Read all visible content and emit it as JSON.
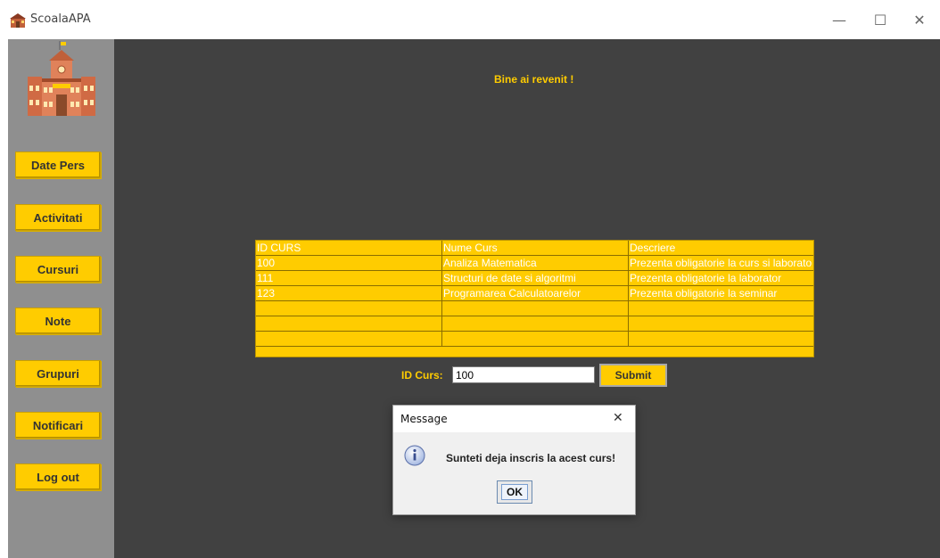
{
  "window": {
    "title": "ScoalaAPA",
    "icon": "school-icon",
    "controls": {
      "minimize": "—",
      "maximize": "☐",
      "close": "✕"
    }
  },
  "sidebar": {
    "logo": "school-building-logo",
    "items": [
      {
        "label": "Date Pers"
      },
      {
        "label": "Activitati"
      },
      {
        "label": "Cursuri"
      },
      {
        "label": "Note"
      },
      {
        "label": "Grupuri"
      },
      {
        "label": "Notificari"
      },
      {
        "label": "Log out"
      }
    ]
  },
  "main": {
    "welcome": "Bine ai revenit !",
    "table": {
      "headers": [
        "ID CURS",
        "Nume Curs",
        "Descriere"
      ],
      "rows": [
        [
          "100",
          "Analiza Matematica",
          "Prezenta obligatorie la curs si laborato"
        ],
        [
          "111",
          "Structuri de date si algoritmi",
          "Prezenta obligatorie la laborator"
        ],
        [
          "123",
          "Programarea Calculatoarelor",
          "Prezenta obligatorie la seminar"
        ],
        [
          "",
          "",
          ""
        ],
        [
          "",
          "",
          ""
        ],
        [
          "",
          "",
          ""
        ]
      ]
    },
    "id_label": "ID Curs:",
    "id_value": "100",
    "submit_label": "Submit"
  },
  "dialog": {
    "title": "Message",
    "close": "✕",
    "icon": "info-icon",
    "message": "Sunteti deja inscris la acest curs!",
    "ok_label": "OK"
  },
  "colors": {
    "accent": "#ffcc00",
    "main_bg": "#414141",
    "sidebar_bg": "#8f8f8f"
  }
}
